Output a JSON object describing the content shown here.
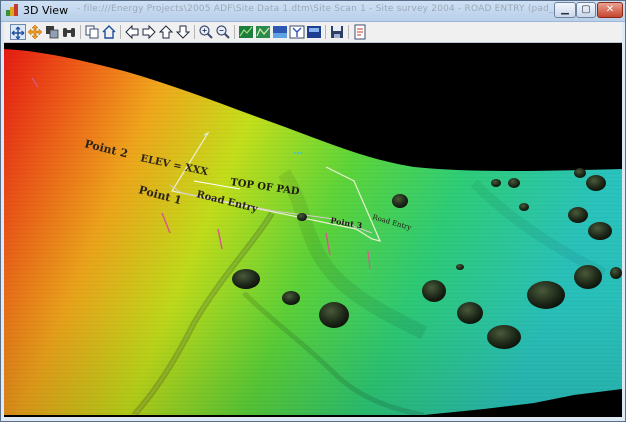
{
  "window": {
    "title": "3D View",
    "faded_title": "- file:///Energy Projects\\2005 ADF\\Site Data 1.dtm\\Site Scan 1 - Site survey 2004 - ROAD ENTRY (pad_site_field.gpro)"
  },
  "window_controls": {
    "minimize": "▁",
    "maximize": "▢",
    "close": "✕"
  },
  "toolbar": {
    "buttons": [
      {
        "name": "select-tool",
        "icon": "select-arrows-icon"
      },
      {
        "name": "pan-tool",
        "icon": "pan-arrows-icon"
      },
      {
        "name": "layers-tool",
        "icon": "layers-icon"
      },
      {
        "name": "binoculars-tool",
        "icon": "binoculars-icon"
      },
      {
        "name": "copy-view",
        "icon": "copy-icon"
      },
      {
        "name": "home-view",
        "icon": "home-icon"
      },
      {
        "name": "move-left",
        "icon": "arrow-left-icon"
      },
      {
        "name": "move-right",
        "icon": "arrow-right-icon"
      },
      {
        "name": "move-up",
        "icon": "arrow-up-icon"
      },
      {
        "name": "move-down",
        "icon": "arrow-down-icon"
      },
      {
        "name": "zoom-in",
        "icon": "zoom-in-icon"
      },
      {
        "name": "zoom-out",
        "icon": "zoom-out-icon"
      },
      {
        "name": "surface-1",
        "icon": "surface-icon"
      },
      {
        "name": "surface-2",
        "icon": "surface-icon"
      },
      {
        "name": "surface-3",
        "icon": "surface-icon"
      },
      {
        "name": "surface-4",
        "icon": "surface-icon"
      },
      {
        "name": "surface-5",
        "icon": "surface-icon"
      },
      {
        "name": "save",
        "icon": "save-icon"
      },
      {
        "name": "export",
        "icon": "export-icon"
      }
    ]
  },
  "scene": {
    "labels": {
      "point2": "Point 2",
      "elev": "ELEV = XXX",
      "top_of_pad": "TOP OF PAD",
      "point1": "Point 1",
      "road_entry_1": "Road Entry",
      "point3": "Point 3",
      "road_entry_2": "Road Entry"
    },
    "colors": {
      "high": "#e51b12",
      "mid_high": "#f2a81c",
      "mid": "#c6e21b",
      "low": "#3ed247",
      "lowest": "#2bc7c1",
      "background": "#000000"
    }
  }
}
